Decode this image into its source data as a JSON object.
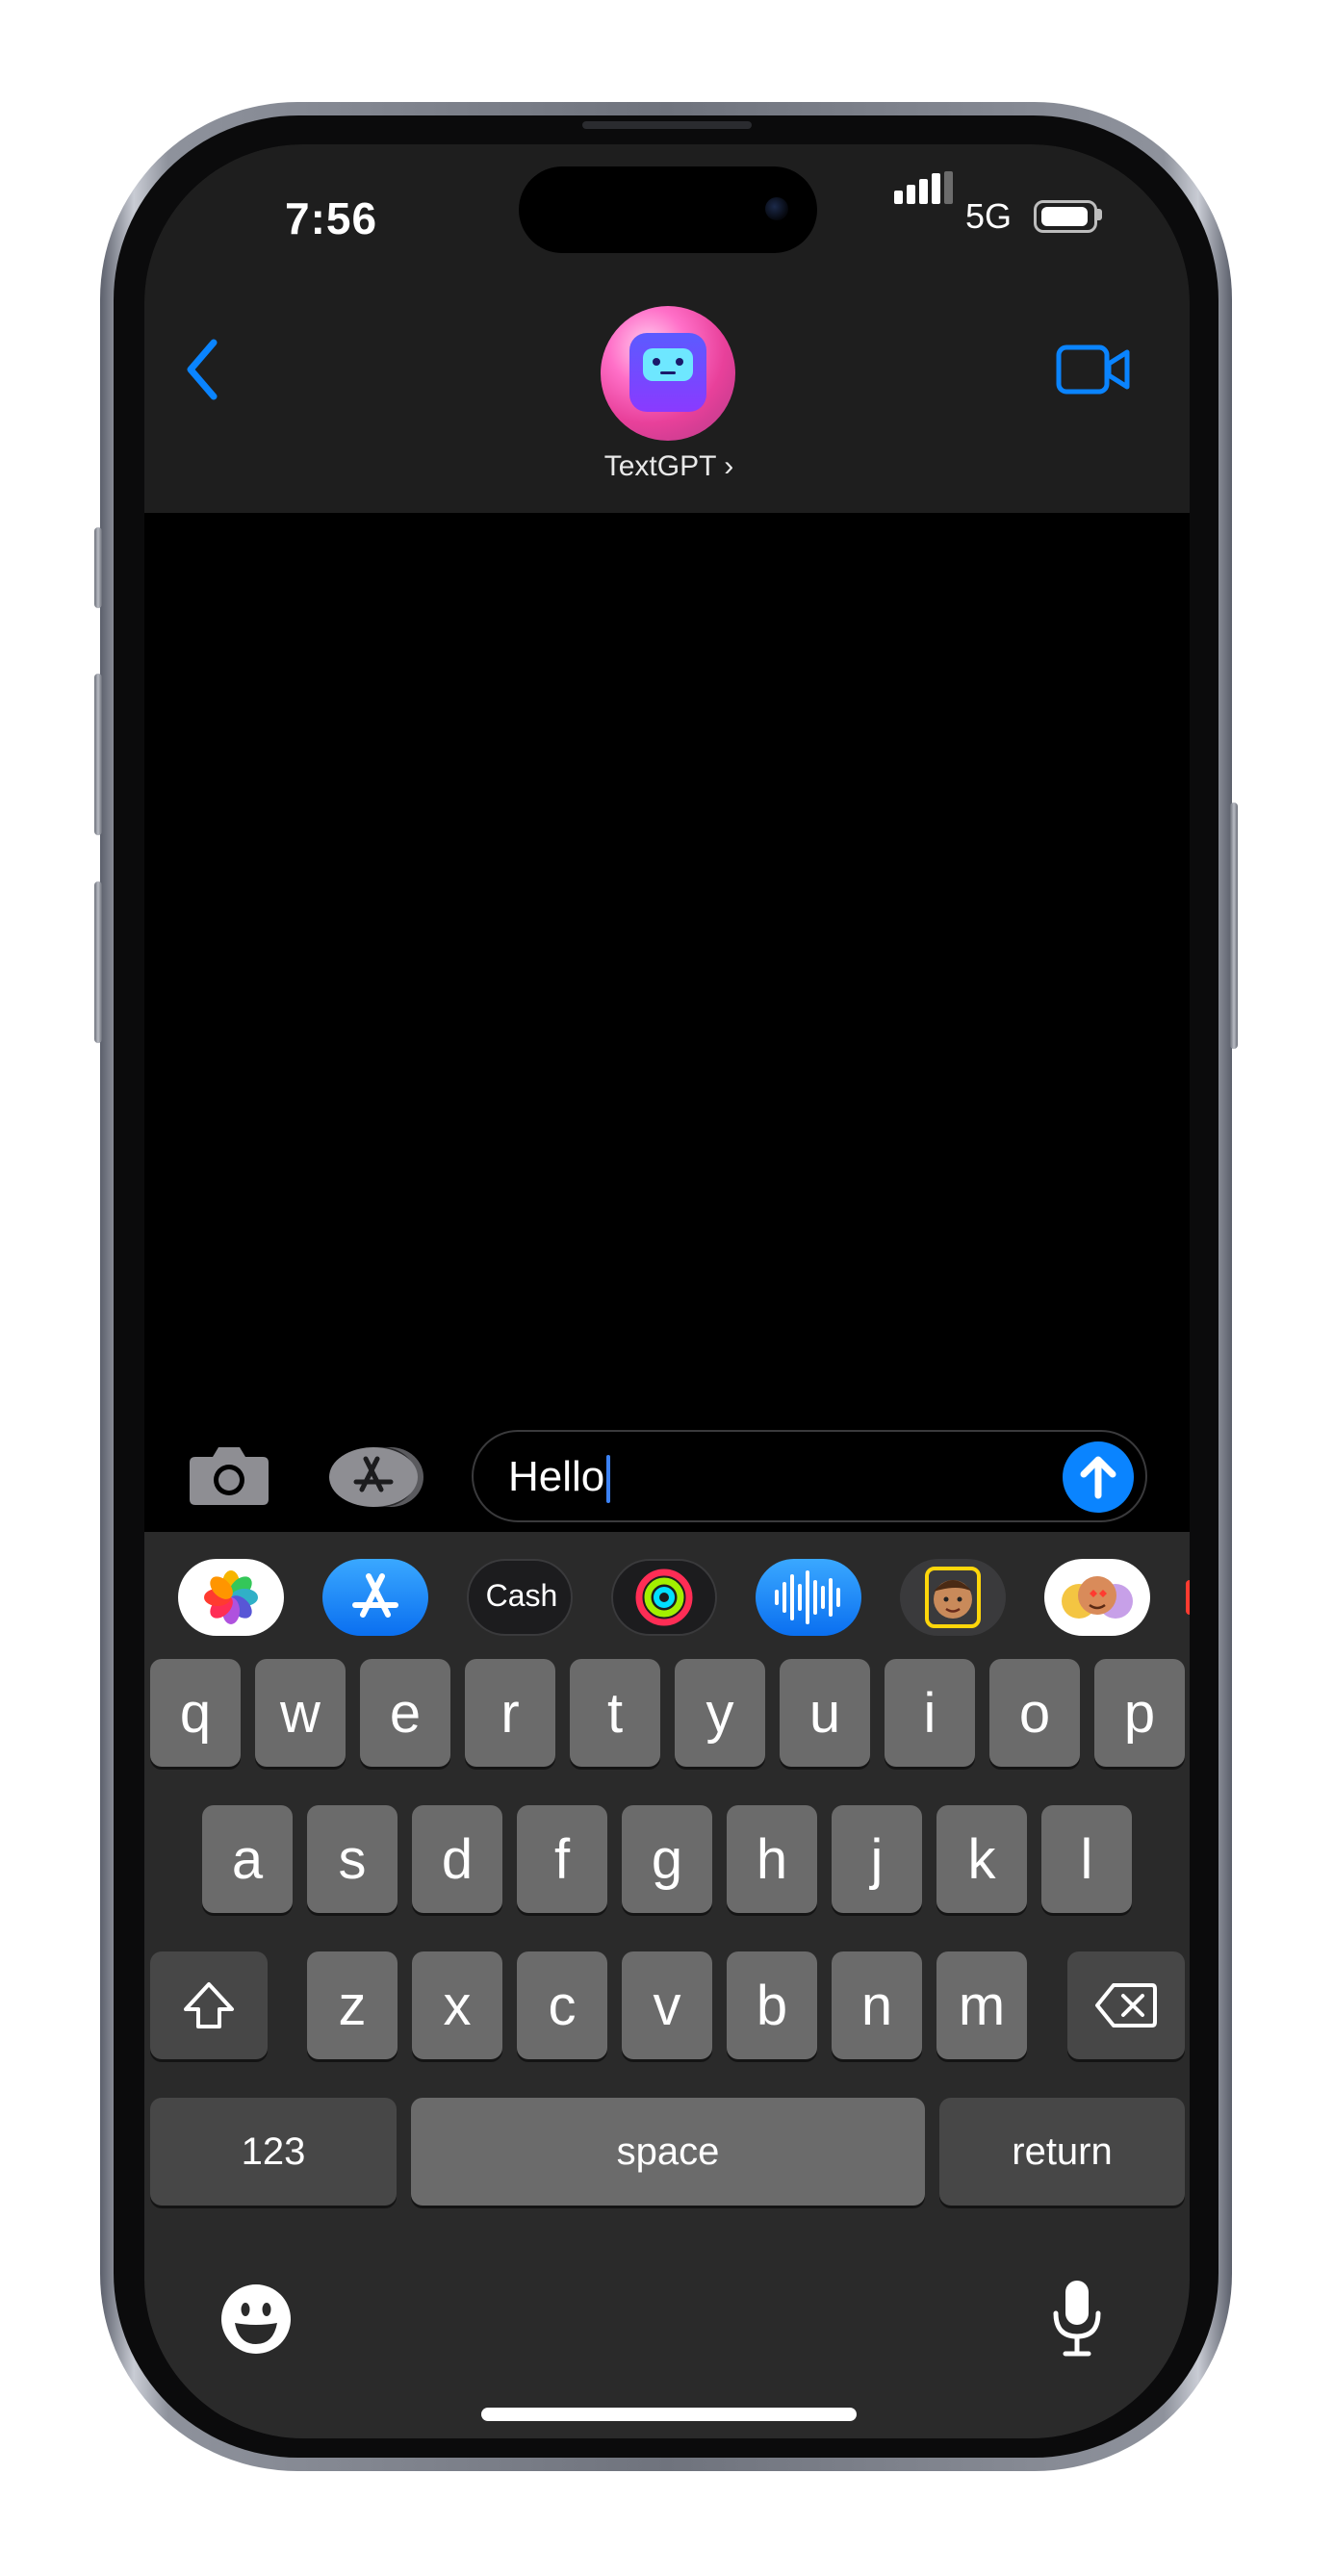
{
  "status_bar": {
    "time": "7:56",
    "network": "5G"
  },
  "header": {
    "contact_name": "TextGPT ›"
  },
  "composer": {
    "message_text": "Hello"
  },
  "app_drawer": {
    "apps": [
      {
        "name": "photos-app-icon"
      },
      {
        "name": "app-store-app-icon"
      },
      {
        "name": "apple-cash-app-icon",
        "label": "Cash"
      },
      {
        "name": "fitness-app-icon"
      },
      {
        "name": "audio-message-app-icon"
      },
      {
        "name": "memoji-app-icon"
      },
      {
        "name": "memoji-stickers-app-icon"
      }
    ]
  },
  "keyboard": {
    "row1": [
      "q",
      "w",
      "e",
      "r",
      "t",
      "y",
      "u",
      "i",
      "o",
      "p"
    ],
    "row2": [
      "a",
      "s",
      "d",
      "f",
      "g",
      "h",
      "j",
      "k",
      "l"
    ],
    "row3": [
      "z",
      "x",
      "c",
      "v",
      "b",
      "n",
      "m"
    ],
    "numbers_label": "123",
    "space_label": "space",
    "return_label": "return"
  },
  "colors": {
    "accent": "#0a84ff",
    "key": "#6b6b6b",
    "key_dark": "#474747",
    "keyboard_bg": "#2a2a2a"
  }
}
